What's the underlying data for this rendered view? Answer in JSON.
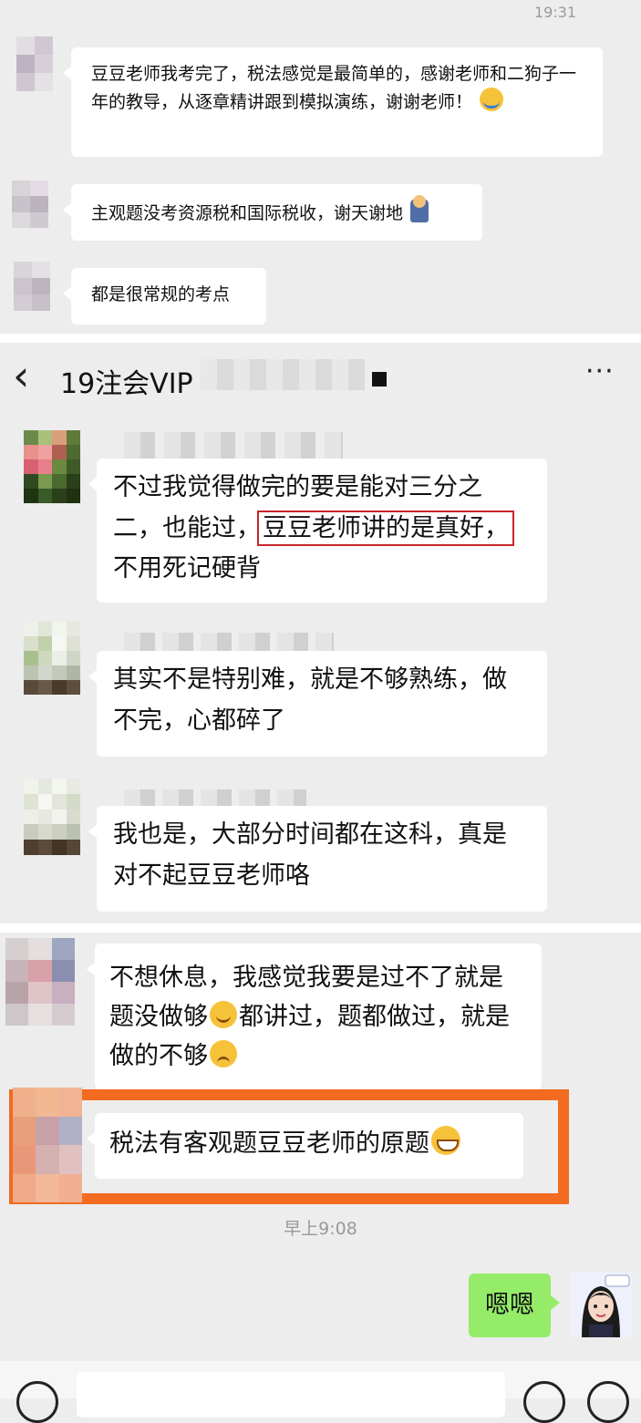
{
  "section1": {
    "timestamp": "19:31",
    "messages": [
      {
        "text": "豆豆老师我考完了，税法感觉是最简单的，感谢老师和二狗子一年的教导，从逐章精讲跟到模拟演练，谢谢老师！",
        "emoji": "crying-emoji"
      },
      {
        "text": "主观题没考资源税和国际税收，谢天谢地",
        "emoji": "kneeling-emoji"
      },
      {
        "text": "都是很常规的考点"
      }
    ]
  },
  "section2": {
    "header": {
      "back": "‹",
      "title": "19注会VIP",
      "more": "···"
    },
    "messages": [
      {
        "line1": "不过我觉得做完的要是能对三分之",
        "line2a": "二，也能过，",
        "highlight": "豆豆老师讲的是真好，",
        "line3": "不用死记硬背"
      },
      {
        "text": "其实不是特别难，就是不够熟练，做不完，心都碎了"
      },
      {
        "text": "我也是，大部分时间都在这科，真是对不起豆豆老师咯"
      }
    ]
  },
  "section3": {
    "messages": [
      {
        "part1": "不想休息，我感觉我要是过不了就是题没做够",
        "part2": "都讲过，题都做过，就是做的不够"
      },
      {
        "text": "税法有客观题豆豆老师的原题"
      }
    ],
    "timestamp": "早上9:08",
    "sent": {
      "text": "嗯嗯"
    }
  },
  "colors": {
    "highlight_red": "#c8242b",
    "highlight_orange": "#f26b21",
    "sent_bubble": "#95ec69"
  }
}
